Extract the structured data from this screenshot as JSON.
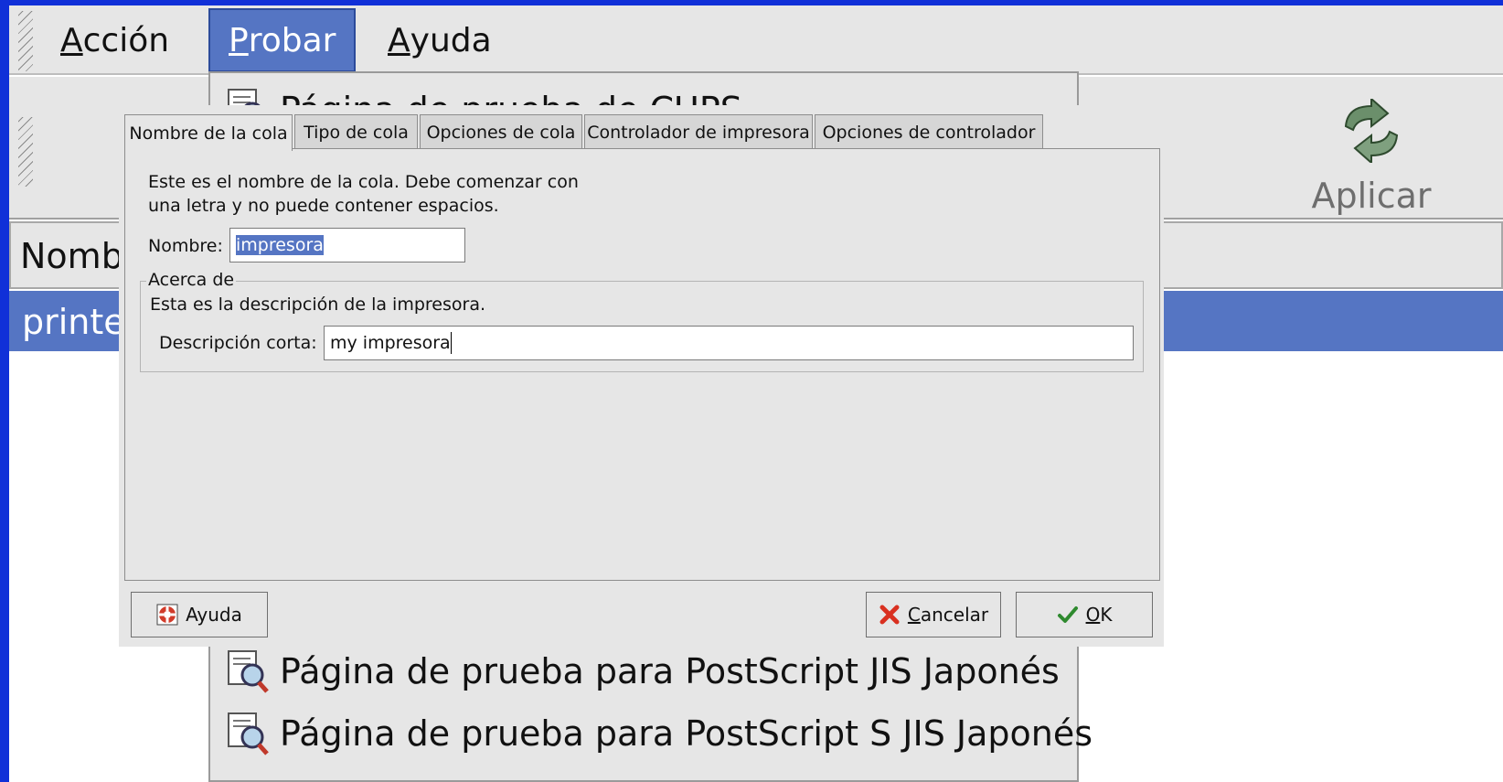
{
  "colors": {
    "desktop": "#1030d8",
    "selection": "#5575c3",
    "window_bg": "#e6e6e6"
  },
  "menubar": {
    "items": [
      {
        "mnemonic": "A",
        "rest": "cción"
      },
      {
        "mnemonic": "P",
        "rest": "robar"
      },
      {
        "mnemonic": "A",
        "rest": "yuda"
      }
    ]
  },
  "toolbar": {
    "apply_label": "Aplicar",
    "apply_icon": "apply-arrows-icon"
  },
  "list": {
    "header": "Nombre",
    "selected_row": "printer"
  },
  "test_menu": {
    "items": [
      {
        "label": "Página de prueba de CUPS",
        "icon": "test-page-icon"
      },
      {
        "label": "Página de prueba para PostScript JIS Japonés",
        "icon": "test-page-icon"
      },
      {
        "label": "Página de prueba para PostScript S JIS Japonés",
        "icon": "test-page-icon"
      }
    ]
  },
  "dialog": {
    "tabs": [
      "Nombre de la cola",
      "Tipo de cola",
      "Opciones de cola",
      "Controlador de impresora",
      "Opciones de controlador"
    ],
    "active_tab": "Nombre de la cola",
    "intro_line1": "Este es el nombre de la cola. Debe comenzar con",
    "intro_line2": "una letra y no puede contener espacios.",
    "name_label": "Nombre:",
    "name_value": "impresora",
    "about_legend": "Acerca de",
    "about_text": "Esta es la descripción de la impresora.",
    "short_desc_label": "Descripción corta:",
    "short_desc_value": "my impresora",
    "buttons": {
      "help": "Ayuda",
      "cancel_mnemonic": "C",
      "cancel_rest": "ancelar",
      "ok_mnemonic": "O",
      "ok_rest": "K"
    }
  }
}
